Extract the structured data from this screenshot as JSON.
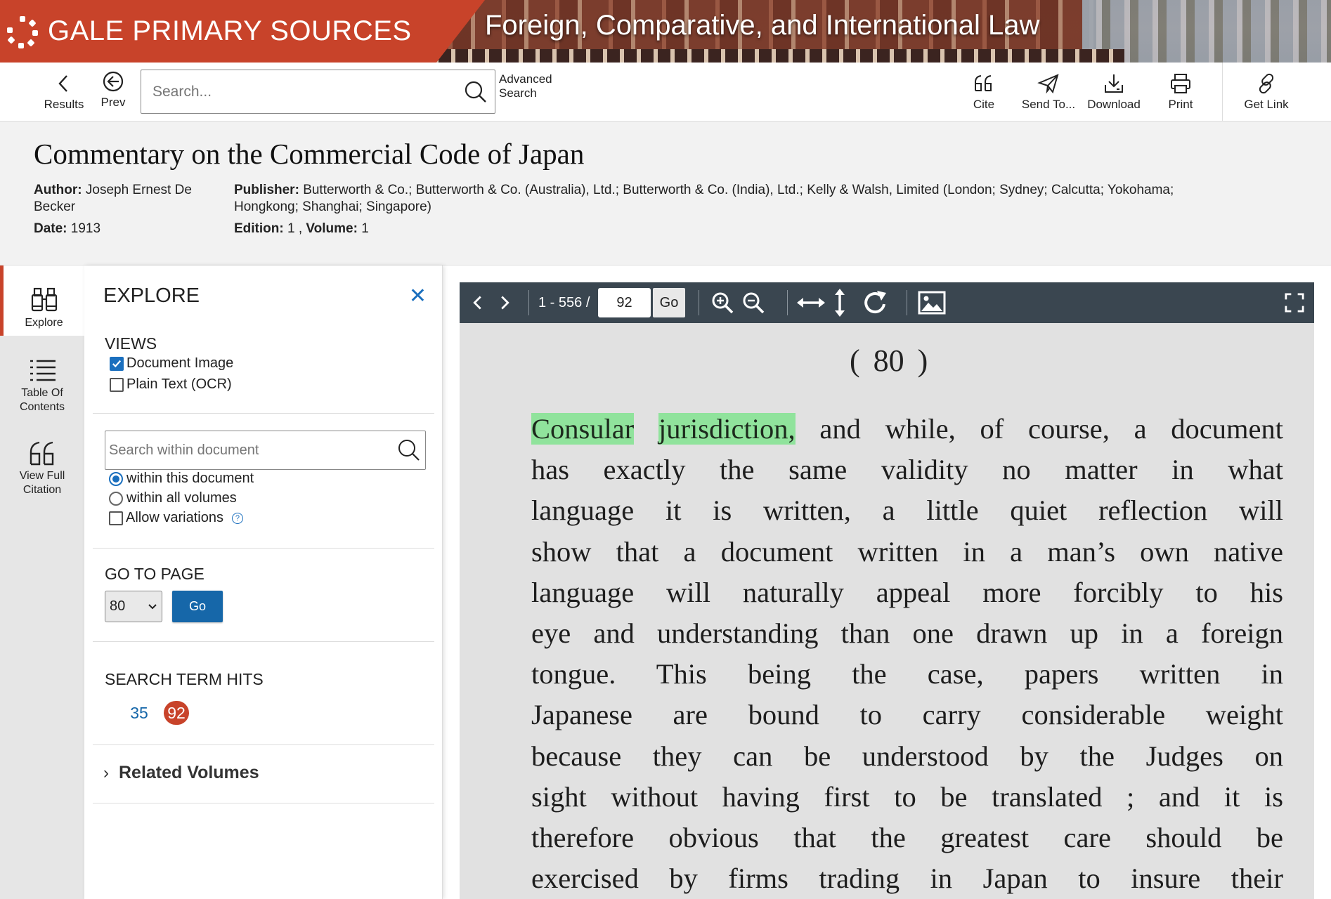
{
  "banner": {
    "brand": "GALE PRIMARY SOURCES",
    "collection": "Foreign, Comparative, and International Law"
  },
  "toolbar": {
    "results_label": "Results",
    "prev_label": "Prev",
    "search_placeholder": "Search...",
    "advanced_line1": "Advanced",
    "advanced_line2": "Search",
    "cite_label": "Cite",
    "send_label": "Send To...",
    "download_label": "Download",
    "print_label": "Print",
    "getlink_label": "Get Link"
  },
  "document": {
    "title": "Commentary on the Commercial Code of Japan",
    "author_label": "Author:",
    "author": "Joseph Ernest De Becker",
    "date_label": "Date:",
    "date": "1913",
    "publisher_label": "Publisher:",
    "publisher": "Butterworth & Co.; Butterworth & Co. (Australia), Ltd.; Butterworth & Co. (India), Ltd.; Kelly & Walsh, Limited (London; Sydney; Calcutta; Yokohama; Hongkong; Shanghai; Singapore)",
    "edition_label": "Edition:",
    "edition": "1",
    "volume_label": "Volume:",
    "volume": "1"
  },
  "rail": {
    "explore": "Explore",
    "toc_line1": "Table Of",
    "toc_line2": "Contents",
    "citation_line1": "View Full",
    "citation_line2": "Citation"
  },
  "explore": {
    "title": "EXPLORE",
    "views_title": "VIEWS",
    "view_image": "Document Image",
    "view_ocr": "Plain Text (OCR)",
    "within_placeholder": "Search within document",
    "opt_this_doc": "within this document",
    "opt_all_vols": "within all volumes",
    "opt_variations": "Allow variations",
    "goto_title": "GO TO PAGE",
    "goto_value": "80",
    "go_label": "Go",
    "hits_title": "SEARCH TERM HITS",
    "hits": [
      "35",
      "92"
    ],
    "related": "Related Volumes"
  },
  "viewer": {
    "range": "1 - 556 /",
    "page": "92",
    "go_label": "Go",
    "page_number": "( 80 )",
    "highlight_1": "Consular",
    "highlight_2": "jurisdiction,",
    "lines": [
      "and while, of course, a document",
      "has exactly the same validity no matter in what",
      "language it is written, a little quiet reflection will",
      "show that a document written in a man’s own native",
      "language will naturally appeal more forcibly to his",
      "eye and understanding than one drawn up in a foreign",
      "tongue.  This being the case, papers written in",
      "Japanese are bound to carry considerable weight",
      "because they can be understood by the Judges on",
      "sight without having first to be translated ; and it is",
      "therefore obvious that the greatest care should be",
      "exercised by firms trading in Japan to insure their"
    ]
  },
  "colors": {
    "brand_red": "#c8432a",
    "link_blue": "#1a6fbe",
    "viewer_bar": "#3a4650",
    "highlight": "#90e39c"
  }
}
